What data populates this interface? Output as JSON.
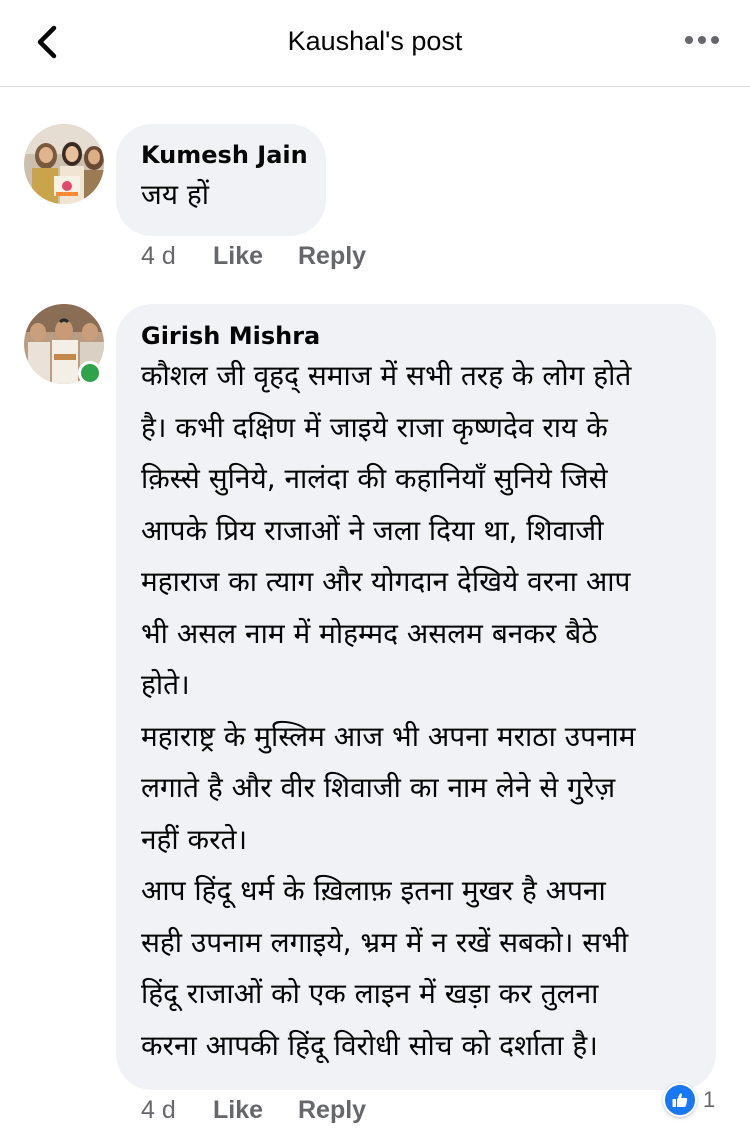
{
  "header": {
    "title": "Kaushal's post",
    "back_icon": "chevron-left-icon",
    "more_icon": "more-horizontal-icon"
  },
  "comments": [
    {
      "author": "Kumesh Jain",
      "text": "जय हों",
      "time": "4 d",
      "like_label": "Like",
      "reply_label": "Reply"
    },
    {
      "author": "Girish Mishra",
      "online": true,
      "text": "कौशल जी वृहद् समाज में सभी तरह के लोग होते\nहै। कभी दक्षिण में जाइये राजा कृष्णदेव राय के\nक़िस्से सुनिये, नालंदा की कहानियाँ सुनिये जिसे\nआपके प्रिय राजाओं ने जला दिया था, शिवाजी\nमहाराज का त्याग और योगदान देखिये वरना आप\nभी असल नाम में मोहम्मद असलम बनकर बैठे\nहोते।\nमहाराष्ट्र के मुस्लिम आज भी अपना मराठा उपनाम\nलगाते है और वीर शिवाजी का नाम लेने से गुरेज़\nनहीं करते।\nआप हिंदू धर्म के ख़िलाफ़ इतना मुखर है अपना\nसही उपनाम लगाइये, भ्रम में न रखें सबको।  सभी\nहिंदू राजाओं को एक लाइन में खड़ा कर तुलना\nकरना आपकी हिंदू विरोधी सोच को दर्शाता है।",
      "time": "4 d",
      "like_label": "Like",
      "reply_label": "Reply",
      "reaction_icon": "thumbs-up-icon",
      "reaction_count": "1"
    }
  ],
  "colors": {
    "bubble": "#f0f2f5",
    "meta_text": "#65676b",
    "like_blue": "#1877f2",
    "online_green": "#31a24c"
  }
}
